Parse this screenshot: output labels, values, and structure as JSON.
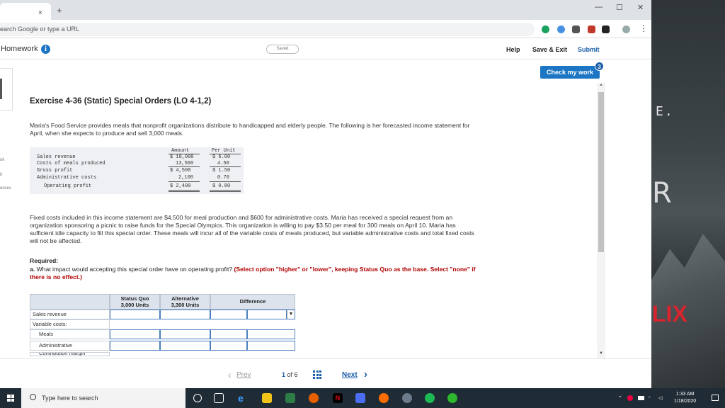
{
  "browser": {
    "tab_close": "×",
    "new_tab": "+",
    "minimize": "—",
    "maximize": "☐",
    "close": "✕",
    "omnibox_placeholder": "earch Google or type a URL",
    "menu": "⋮"
  },
  "homework_bar": {
    "title": "Homework",
    "info_icon": "i",
    "saved": "Saved",
    "help": "Help",
    "save_exit": "Save & Exit",
    "submit": "Submit"
  },
  "check_work": {
    "label": "Check my work",
    "badge": "3"
  },
  "sidebar_fragments": [
    "ok",
    "it",
    "ences"
  ],
  "exercise": {
    "title": "Exercise 4-36 (Static) Special Orders (LO 4-1,2)",
    "intro": "Maria's Food Service provides meals that nonprofit organizations distribute to handicapped and elderly people. The following is her forecasted income statement for April, when she expects to produce and sell 3,000 meals.",
    "income_statement": {
      "col_amount": "Amount",
      "col_per_unit": "Per Unit",
      "rows": [
        {
          "label": "Sales revenue",
          "amount": "$ 18,000",
          "per_unit": "$ 6.00"
        },
        {
          "label": "Costs of meals produced",
          "amount": "13,500",
          "per_unit": "4.50"
        },
        {
          "label": "Gross profit",
          "amount": "$ 4,500",
          "per_unit": "$ 1.50"
        },
        {
          "label": "Administrative costs",
          "amount": "2,100",
          "per_unit": "0.70"
        },
        {
          "label": "Operating profit",
          "amount": "$ 2,400",
          "per_unit": "$ 0.80"
        }
      ]
    },
    "facts": "Fixed costs included in this income statement are $4,500 for meal production and $600 for administrative costs. Maria has received a special request from an organization sponsoring a picnic to raise funds for the Special Olympics. This organization is willing to pay $3.50 per meal for 300 meals on April 10. Maria has sufficient idle capacity to fill this special order. These meals will incur all of the variable costs of meals produced, but variable administrative costs and total fixed costs will not be affected.",
    "required_title": "Required:",
    "question_prefix": "a.",
    "question": "What impact would accepting this special order have on operating profit?",
    "question_hint": "(Select option \"higher\" or \"lower\", keeping Status Quo as the base. Select \"none\" if there is no effect.)"
  },
  "answer_table": {
    "headers": {
      "status_quo": "Status Quo\n3,000 Units",
      "alternative": "Alternative\n3,300 Units",
      "difference": "Difference"
    },
    "rows": [
      "Sales revenue",
      "Variable costs:",
      "Meals",
      "Administrative",
      "Contribution margin"
    ],
    "dropdown_arrow": "▼"
  },
  "pager": {
    "prev": "Prev",
    "prev_arrow": "‹",
    "page_current": "1",
    "page_of": "of 6",
    "next": "Next",
    "next_arrow": "›"
  },
  "wallpaper": {
    "letters_top": "E.",
    "letter_mid": "R",
    "letters_bottom": "LIX"
  },
  "taskbar": {
    "search_placeholder": "Type here to search",
    "time": "1:33 AM",
    "date": "1/18/2020"
  }
}
